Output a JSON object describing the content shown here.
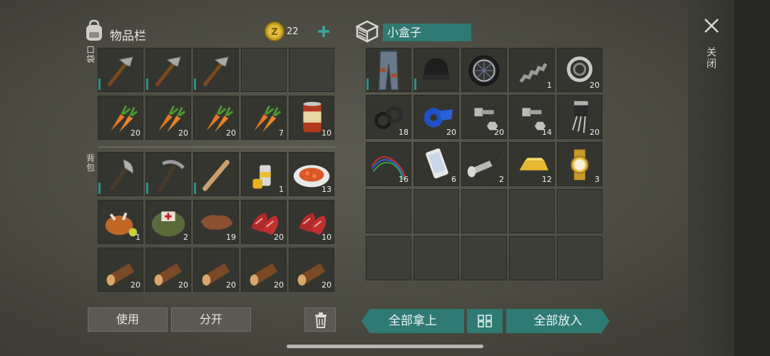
{
  "inventory": {
    "title": "物品栏",
    "coin_count": "22",
    "pocket_label": "口袋",
    "backpack_label": "背包",
    "pocket_slots": [
      {
        "icon": "hammer-icon",
        "count": "",
        "durability": true
      },
      {
        "icon": "hammer-icon",
        "count": "",
        "durability": true
      },
      {
        "icon": "hammer-icon",
        "count": "",
        "durability": true
      },
      {
        "icon": "",
        "count": ""
      },
      {
        "icon": "",
        "count": ""
      },
      {
        "icon": "carrot-icon",
        "count": "20"
      },
      {
        "icon": "carrot-icon",
        "count": "20"
      },
      {
        "icon": "carrot-icon",
        "count": "20"
      },
      {
        "icon": "carrot-icon",
        "count": "7"
      },
      {
        "icon": "canned-food-icon",
        "count": "10"
      }
    ],
    "backpack_slots": [
      {
        "icon": "axe-icon",
        "count": "",
        "durability": true
      },
      {
        "icon": "pickaxe-icon",
        "count": "",
        "durability": true
      },
      {
        "icon": "baseball-bat-icon",
        "count": "",
        "durability": true
      },
      {
        "icon": "spray-can-icon",
        "count": "1"
      },
      {
        "icon": "food-plate-icon",
        "count": "13"
      },
      {
        "icon": "roast-chicken-icon",
        "count": "1"
      },
      {
        "icon": "first-aid-bag-icon",
        "count": "2"
      },
      {
        "icon": "leather-icon",
        "count": "19"
      },
      {
        "icon": "raw-meat-icon",
        "count": "20"
      },
      {
        "icon": "raw-meat-icon",
        "count": "10"
      },
      {
        "icon": "log-icon",
        "count": "20"
      },
      {
        "icon": "log-icon",
        "count": "20"
      },
      {
        "icon": "log-icon",
        "count": "20"
      },
      {
        "icon": "log-icon",
        "count": "20"
      },
      {
        "icon": "log-icon",
        "count": "20"
      }
    ],
    "use_label": "使用",
    "split_label": "分开"
  },
  "container": {
    "title": "小盒子",
    "slots": [
      {
        "icon": "pants-icon",
        "count": "",
        "durability": true
      },
      {
        "icon": "beanie-icon",
        "count": "",
        "durability": true
      },
      {
        "icon": "wheel-icon",
        "count": ""
      },
      {
        "icon": "spring-icon",
        "count": "1"
      },
      {
        "icon": "bearing-icon",
        "count": "20"
      },
      {
        "icon": "rubber-rings-icon",
        "count": "18"
      },
      {
        "icon": "tape-icon",
        "count": "20"
      },
      {
        "icon": "bolt-nut-icon",
        "count": "20"
      },
      {
        "icon": "bolt-nut-icon",
        "count": "14"
      },
      {
        "icon": "transistor-icon",
        "count": "20"
      },
      {
        "icon": "wires-icon",
        "count": "16"
      },
      {
        "icon": "smartphone-icon",
        "count": "6"
      },
      {
        "icon": "flashlight-icon",
        "count": "2"
      },
      {
        "icon": "gold-bar-icon",
        "count": "12"
      },
      {
        "icon": "gold-watch-icon",
        "count": "3"
      }
    ],
    "take_all_label": "全部拿上",
    "put_all_label": "全部放入"
  },
  "close_label": "关闭"
}
